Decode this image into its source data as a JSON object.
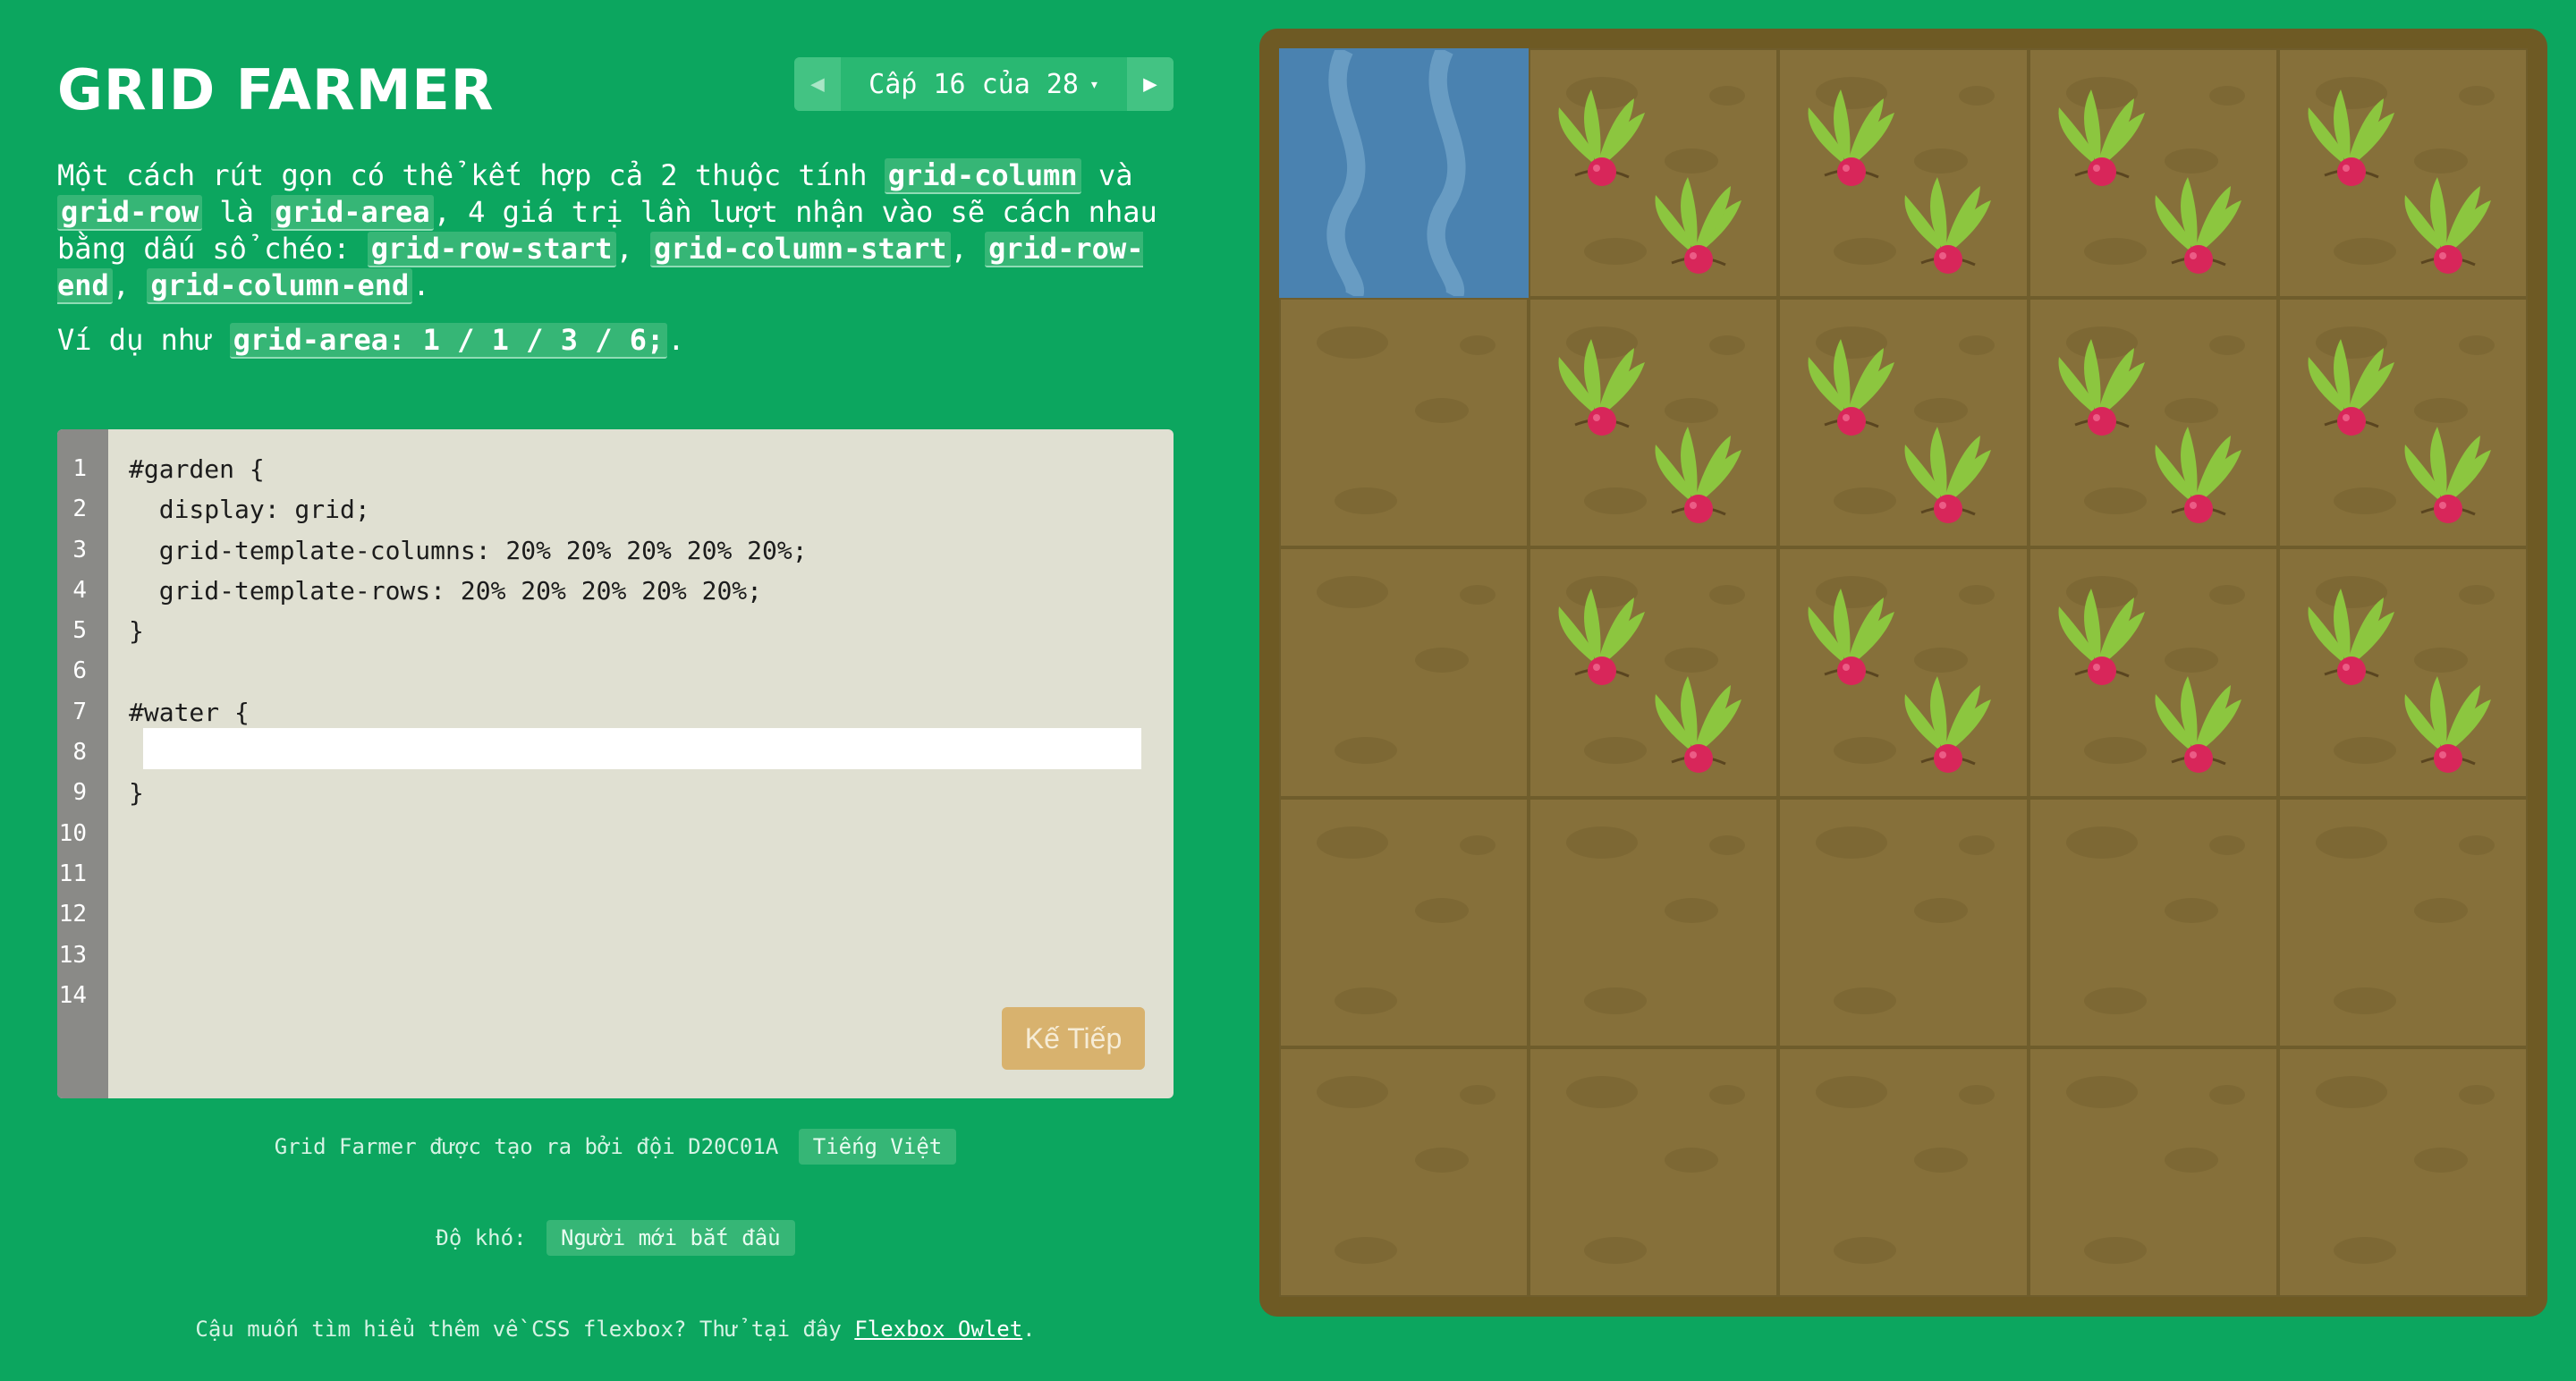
{
  "app": {
    "title": "GRID FARMER"
  },
  "level_nav": {
    "prev_icon": "triangle-left-icon",
    "next_icon": "triangle-right-icon",
    "level_label": "Cấp 16 của 28",
    "caret": "▾"
  },
  "instructions": {
    "p1_a": "Một cách rút gọn có thể kết hợp cả 2 thuộc tính ",
    "p1_code1": "grid-column",
    "p1_b": " và ",
    "p1_code2": "grid-row",
    "p1_c": " là ",
    "p1_code3": "grid-area",
    "p1_d": ", 4 giá trị lần lượt nhận vào sẽ cách nhau bằng dấu sổ chéo: ",
    "p1_code4": "grid-row-start",
    "p1_e": ", ",
    "p1_code5": "grid-column-start",
    "p1_f": ", ",
    "p1_code6": "grid-row-end",
    "p1_g": ", ",
    "p1_code7": "grid-column-end",
    "p1_h": ".",
    "p2_a": "Ví dụ như ",
    "p2_code": "grid-area: 1 / 1 / 3 / 6;",
    "p2_b": "."
  },
  "editor": {
    "line_numbers": [
      "1",
      "2",
      "3",
      "4",
      "5",
      "6",
      "7",
      "8",
      "9",
      "10",
      "11",
      "12",
      "13",
      "14"
    ],
    "lines": [
      "#garden {",
      "  display: grid;",
      "  grid-template-columns: 20% 20% 20% 20% 20%;",
      "  grid-template-rows: 20% 20% 20% 20% 20%;",
      "}",
      "",
      "#water {",
      "",
      "}"
    ],
    "input_value": "",
    "next_button": "Kế Tiếp"
  },
  "footer": {
    "credit_text": "Grid Farmer được tạo ra bởi đội D20C01A",
    "language": "Tiếng Việt",
    "difficulty_label": "Độ khó:",
    "difficulty_value": "Người mới bắt đầu",
    "flexbox_text": "Cậu muốn tìm hiểu thêm về CSS flexbox? Thử tại đây ",
    "flexbox_link": "Flexbox Owlet",
    "flexbox_end": "."
  },
  "garden": {
    "rows": 5,
    "cols": 5,
    "water_cells": [
      [
        1,
        1
      ]
    ],
    "radish_rows": [
      1,
      2,
      3
    ],
    "radish_cols": [
      2,
      3,
      4,
      5
    ],
    "icon": "radish-icon"
  },
  "colors": {
    "background": "#0ca65f",
    "soil": "#86703a",
    "water": "#4a82b0",
    "button": "#d8b26e"
  }
}
